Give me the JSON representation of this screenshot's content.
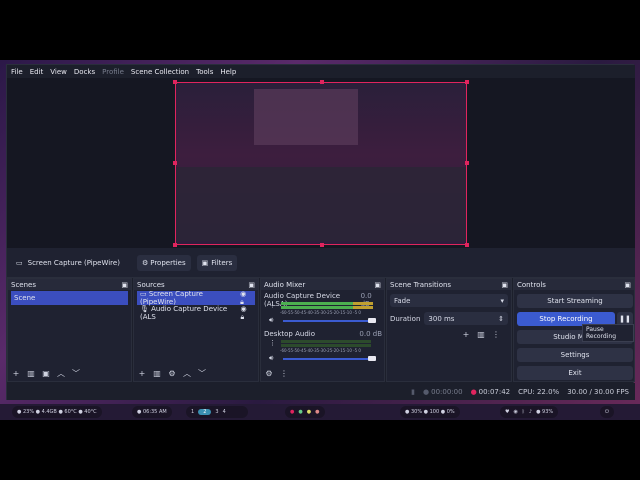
{
  "menu": [
    "File",
    "Edit",
    "View",
    "Docks",
    "Profile",
    "Scene Collection",
    "Tools",
    "Help"
  ],
  "menu_disabled": [
    "Profile"
  ],
  "source_toolbar": {
    "source_name": "Screen Capture (PipeWire)",
    "properties_label": "Properties",
    "filters_label": "Filters"
  },
  "scenes": {
    "title": "Scenes",
    "items": [
      "Scene"
    ]
  },
  "sources": {
    "title": "Sources",
    "items": [
      "Screen Capture (PipeWire)",
      "Audio Capture Device (ALS"
    ]
  },
  "audio_mixer": {
    "title": "Audio Mixer",
    "channels": [
      {
        "name": "Audio Capture Device (ALSA)",
        "level": "0.0 dB"
      },
      {
        "name": "Desktop Audio",
        "level": "0.0 dB"
      }
    ],
    "scale": "-60-55-50-45-40-35-30-25-20-15-10 -5 0"
  },
  "transitions": {
    "title": "Scene Transitions",
    "type": "Fade",
    "duration_label": "Duration",
    "duration_value": "300 ms"
  },
  "controls": {
    "title": "Controls",
    "start_streaming": "Start Streaming",
    "stop_recording": "Stop Recording",
    "studio_mode": "Studio Mode",
    "settings": "Settings",
    "exit": "Exit",
    "tooltip": "Pause Recording"
  },
  "status": {
    "stream_time": "00:00:00",
    "record_time": "00:07:42",
    "cpu": "CPU: 22.0%",
    "fps": "30.00 / 30.00 FPS"
  },
  "taskbar": {
    "left": "● 23% ● 4.4GB ● 60°C ● 40°C",
    "clock": "● 06:35 AM",
    "workspaces": [
      "1",
      "2",
      "3",
      "4"
    ],
    "active_workspace": "2",
    "right": "● 30% ● 100 ● 0%",
    "battery": "● 93%"
  },
  "colors": {
    "accent": "#3b5bd0",
    "recording_red": "#e0245e",
    "panel_bg": "#1f2231"
  }
}
